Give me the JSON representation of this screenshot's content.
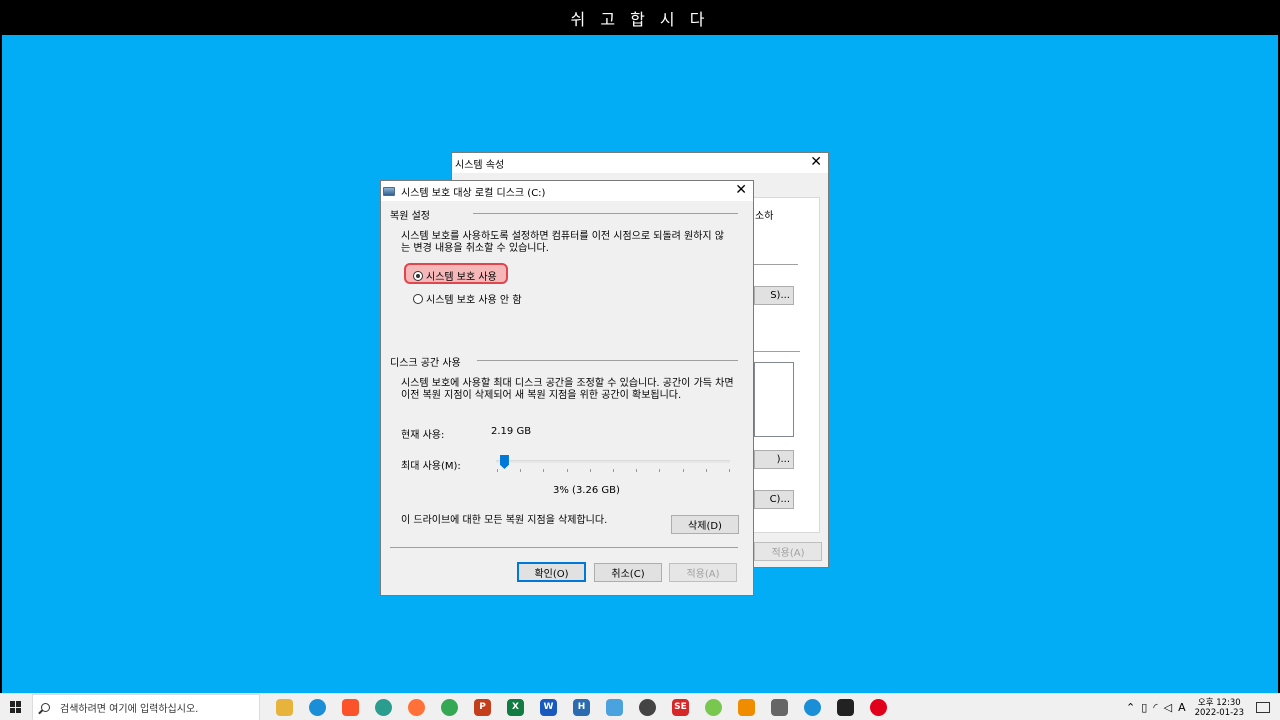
{
  "banner": {
    "text": "쉬 고 합 시 다"
  },
  "back_window": {
    "title": "시스템 속성",
    "frag_top": "소하",
    "btn1": "S)...",
    "btn2": ")...",
    "btn3": "C)...",
    "apply": "적용(A)"
  },
  "dialog": {
    "title": "시스템 보호 대상 로컬 디스크 (C:)",
    "restore": {
      "heading": "복원 설정",
      "description_1": "시스템 보호를 사용하도록 설정하면 컴퓨터를 이전 시점으로 되돌려 원하지 않",
      "description_2": "는 변경 내용을 취소할 수 있습니다.",
      "options": [
        {
          "label": "시스템 보호 사용",
          "checked": true
        },
        {
          "label": "시스템 보호 사용 안 함",
          "checked": false
        }
      ]
    },
    "disk": {
      "heading": "디스크 공간 사용",
      "description_1": "시스템 보호에 사용할 최대 디스크 공간을 조정할 수 있습니다. 공간이 가득 차면",
      "description_2": "이전 복원 지점이 삭제되어 새 복원 지점을 위한 공간이 확보됩니다.",
      "current_label": "현재 사용:",
      "current_value": "2.19 GB",
      "max_label": "최대 사용(M):",
      "max_percent": 3,
      "max_text": "3% (3.26 GB)",
      "delete_text": "이 드라이브에 대한 모든 복원 지점을 삭제합니다.",
      "delete_button": "삭제(D)"
    },
    "buttons": {
      "ok": "확인(O)",
      "cancel": "취소(C)",
      "apply": "적용(A)"
    }
  },
  "taskbar": {
    "search_placeholder": "검색하려면 여기에 입력하십시오.",
    "ime": "A",
    "time": "오후 12:30",
    "date": "2022-01-23"
  }
}
